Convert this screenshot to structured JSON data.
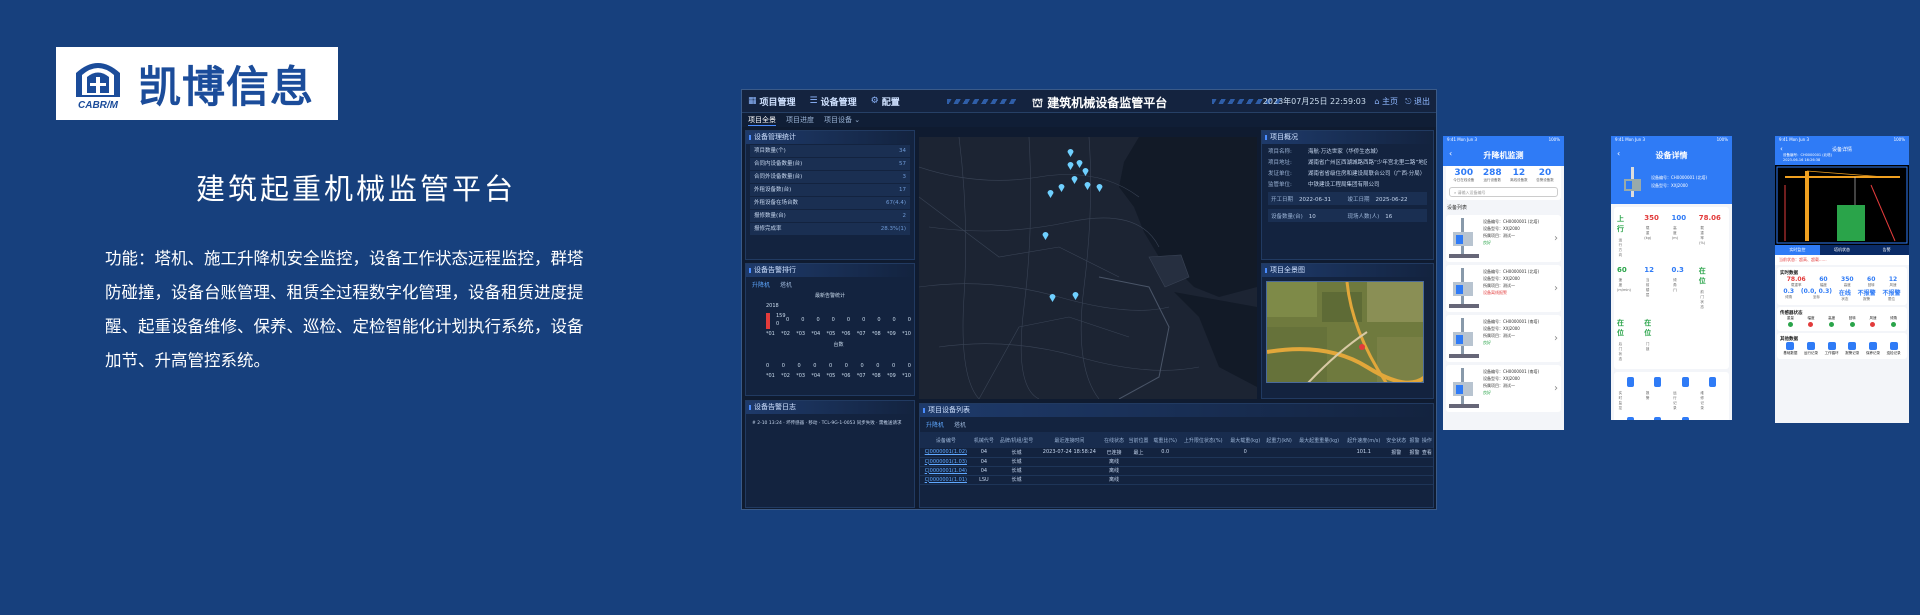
{
  "brand": {
    "name": "凯博信息",
    "abbr": "CABR/M"
  },
  "slide": {
    "title": "建筑起重机械监管平台",
    "description": "功能：塔机、施工升降机安全监控，设备工作状态远程监控，群塔防碰撞，设备台账管理、租赁全过程数字化管理，设备租赁进度提醒、起重设备维修、保养、巡检、定检智能化计划执行系统，设备加节、升高管控系统。"
  },
  "desktop": {
    "nav": [
      {
        "icon": "grid-icon",
        "label": "项目管理"
      },
      {
        "icon": "list-icon",
        "label": "设备管理"
      },
      {
        "icon": "gear-icon",
        "label": "配置"
      }
    ],
    "title": "建筑机械设备监管平台",
    "datetime": "2023年07月25日 22:59:03",
    "home_label": "主页",
    "exit_label": "退出",
    "subtabs": [
      "项目全景",
      "项目进度",
      "项目设备 ⌄"
    ],
    "stats_panel": {
      "title": "设备管理统计",
      "rows": [
        {
          "label": "项目数量(个)",
          "value": "34"
        },
        {
          "label": "合同内设备数量(台)",
          "value": "57"
        },
        {
          "label": "合同外设备数量(台)",
          "value": "3"
        },
        {
          "label": "外租设备数(台)",
          "value": "17"
        },
        {
          "label": "外租设备在场台数",
          "value": "67(4.4)"
        },
        {
          "label": "报修数量(台)",
          "value": "2"
        },
        {
          "label": "报修完成率",
          "value": "28.3%(1)"
        }
      ]
    },
    "rank_panel": {
      "title": "设备告警排行",
      "tabs": [
        "升降机",
        "塔机"
      ],
      "chart_title": "最新告警统计",
      "year": "2018",
      "chart_label": "台数",
      "top_value": "159",
      "top_zero": "0",
      "row1": [
        "0",
        "0",
        "0",
        "0",
        "0",
        "0",
        "0",
        "0",
        "0"
      ],
      "row2": [
        "0",
        "0",
        "0",
        "0",
        "0",
        "0",
        "0",
        "0",
        "0",
        "0"
      ],
      "xticks": [
        "*01",
        "*02",
        "*03",
        "*04",
        "*05",
        "*06",
        "*07",
        "*08",
        "*09",
        "*10"
      ]
    },
    "logs_panel": {
      "title": "设备告警日志",
      "entry": "# 2-10 13:24 · 坏传感器 · 移动 · TCL-9G-1-0053 同步失败 · 需推送请求"
    },
    "info_panel": {
      "title": "项目概况",
      "rows": [
        {
          "k": "项目名称:",
          "v": "海航·万达世家（华侨生态城）"
        },
        {
          "k": "项目地址:",
          "v": "湖南省广州区西湖城路西路“少年宫北里二路”地区"
        },
        {
          "k": "发证单位:",
          "v": "湖南省省级住房和建设局联合公司（广西·分局）"
        },
        {
          "k": "监管单位:",
          "v": "中铁建设工程局集团有限公司"
        }
      ],
      "grid": [
        {
          "k": "开工日期",
          "v": "2022-06-31"
        },
        {
          "k": "竣工日期",
          "v": "2025-06-22"
        },
        {
          "k": "设备数量(台)",
          "v": "10"
        },
        {
          "k": "现场人数(人)",
          "v": "16"
        }
      ]
    },
    "sat_panel": {
      "title": "项目全景图"
    },
    "table_panel": {
      "title": "项目设备列表",
      "tabs": [
        "升降机",
        "塔机"
      ],
      "headers": [
        "设备编号",
        "机械代号",
        "品牌/机组/型号",
        "最近连接时间",
        "在线状态",
        "当前位置",
        "载重比(%)",
        "上升限位状态(%)",
        "最大载重(kg)",
        "起重力(kN)",
        "最大起重重量(kg)",
        "起升速度(m/s)",
        "安全状态",
        "报警",
        "操作"
      ],
      "rows": [
        [
          "CJ0000001(1.02)",
          "04",
          "长城",
          "2023-07-24 18:58:24",
          "已连接",
          "最上",
          "0.0",
          "",
          "0",
          "",
          "",
          "101.1",
          "报警",
          "报警",
          "查看"
        ],
        [
          "CJ0000001(1.03)",
          "04",
          "长城",
          "",
          "离线",
          "",
          "",
          "",
          "",
          "",
          "",
          "",
          "",
          "",
          ""
        ],
        [
          "CJ0000001(1.04)",
          "04",
          "长城",
          "",
          "离线",
          "",
          "",
          "",
          "",
          "",
          "",
          "",
          "",
          "",
          ""
        ],
        [
          "CJ0000001(1.01)",
          "LSU",
          "长城",
          "",
          "离线",
          "",
          "",
          "",
          "",
          "",
          "",
          "",
          "",
          "",
          ""
        ]
      ]
    }
  },
  "phone1": {
    "time": "9:41  Mon Jun 3",
    "status": "100%",
    "title": "升降机监测",
    "stats": [
      {
        "v": "300",
        "l": "今日在线设备"
      },
      {
        "v": "288",
        "l": "运行设备数"
      },
      {
        "v": "12",
        "l": "离线设备数"
      },
      {
        "v": "20",
        "l": "告警设备数"
      }
    ],
    "search_placeholder": "请输入设备编号",
    "list_title": "设备列表",
    "devices": [
      {
        "id": "设备编号：CH0000001 (北塔)",
        "model": "设备型号：XXJ2000",
        "place": "所属项目：测试一",
        "state": "良好"
      },
      {
        "id": "设备编号：CH0000001 (北塔)",
        "model": "设备型号：XXJ2000",
        "place": "所属项目：测试一",
        "state": "设备离线报警"
      },
      {
        "id": "设备编号：CH0000001 (南塔)",
        "model": "设备型号：XXJ2000",
        "place": "所属项目：测试一",
        "state": "良好"
      },
      {
        "id": "设备编号：CH0000001 (南塔)",
        "model": "设备型号：XXJ2000",
        "place": "所属项目：测试一",
        "state": "良好"
      }
    ]
  },
  "phone2": {
    "time": "9:41  Mon Jun 3",
    "status": "100%",
    "title": "设备详情",
    "device_id": "设备编号：CH0000001 (北塔)",
    "device_model": "设备型号：XXJ2000",
    "metrics": [
      {
        "v": "上行",
        "l": "运行方向",
        "c": "#2aa44a"
      },
      {
        "v": "350",
        "l": "载重(kg)",
        "c": "#e23b3b"
      },
      {
        "v": "100",
        "l": "高度(m)",
        "c": "#2f7bf6"
      },
      {
        "v": "78.06",
        "l": "载重率(%)",
        "c": "#e23b3b"
      },
      {
        "v": "60",
        "l": "速度(m/min)",
        "c": "#2aa44a"
      },
      {
        "v": "12",
        "l": "当前楼层",
        "c": "#2f7bf6"
      },
      {
        "v": "0.3",
        "l": "倾角(°)",
        "c": "#2f7bf6"
      },
      {
        "v": "在位",
        "l": "前门状态",
        "c": "#2aa44a"
      },
      {
        "v": "在位",
        "l": "后门状态",
        "c": "#2aa44a"
      },
      {
        "v": "在位",
        "l": "门锁",
        "c": "#2aa44a"
      }
    ],
    "actions": [
      "实时监控",
      "报警",
      "运行记录",
      "维修记录",
      "保养记录",
      "巡检记录",
      "设备档案"
    ]
  },
  "phone3": {
    "time": "9:41  Mon Jun 3",
    "status": "100%",
    "title": "设备详情",
    "device_id": "设备编号：CH0000001 (北塔)",
    "time_label": "2023-06-16 16:26:38",
    "tabs": [
      "实时监控",
      "塔机状态",
      "告警"
    ],
    "alert": "当前状态：超高、超载......",
    "realtime_title": "实时数据",
    "realtime": [
      {
        "v": "78.06",
        "l": "载重率"
      },
      {
        "v": "60",
        "l": "幅度"
      },
      {
        "v": "350",
        "l": "高度"
      },
      {
        "v": "60",
        "l": "回转"
      },
      {
        "v": "12",
        "l": "风速"
      }
    ],
    "realtime2": [
      {
        "v": "0.3",
        "l": "倾角"
      },
      {
        "v": "(0.0, 0.3)",
        "l": "坐标"
      },
      {
        "v": "在线",
        "l": "状态"
      },
      {
        "v": "不报警",
        "l": "报警"
      },
      {
        "v": "不报警",
        "l": "限位"
      }
    ],
    "sensor_title": "传感器状态",
    "sensors": [
      "重量",
      "幅度",
      "高度",
      "回转",
      "风速",
      "倾角"
    ],
    "more_title": "其他数据",
    "more": [
      "基础数据",
      "运行记录",
      "工作循环",
      "报警记录",
      "保养记录",
      "巡检记录"
    ]
  },
  "colors": {
    "bg": "#17407d",
    "brand": "#1b4c9a",
    "accent": "#2f7bf6"
  }
}
